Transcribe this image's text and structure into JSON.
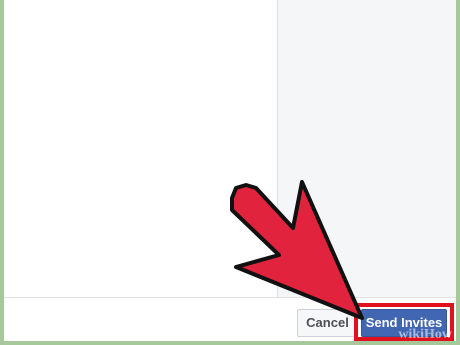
{
  "dialog": {
    "footer": {
      "cancel_label": "Cancel",
      "send_label": "Send Invites"
    }
  },
  "overlay": {
    "arrow_color": "#e2233d",
    "highlight_color": "#e0101f",
    "watermark_text": "wikiHow"
  },
  "colors": {
    "frame_border": "#a6c89a",
    "right_pane_bg": "#f5f6f7",
    "primary_button": "#4267b2"
  }
}
